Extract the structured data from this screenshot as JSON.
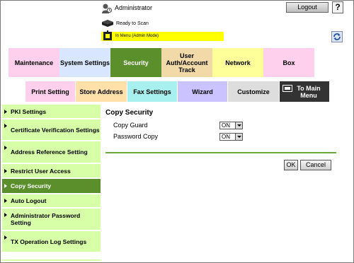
{
  "header": {
    "user_label": "Administrator",
    "logout_label": "Logout",
    "help_label": "?",
    "status_text": "Ready to Scan",
    "mode_text": "In Menu (Admin Mode)"
  },
  "tabs": [
    {
      "label": "Maintenance",
      "color": "#ffd0ee"
    },
    {
      "label": "System Settings",
      "color": "#d8e7ff"
    },
    {
      "label": "Security",
      "color": "#5b8f2c",
      "active": true
    },
    {
      "label": "User Auth/Account Track",
      "color": "#f2d9a8"
    },
    {
      "label": "Network",
      "color": "#ffff99"
    },
    {
      "label": "Box",
      "color": "#ffd0ee"
    }
  ],
  "subtabs": [
    {
      "label": "Print Setting",
      "color": "#ffd0ee"
    },
    {
      "label": "Store Address",
      "color": "#ffe0a8"
    },
    {
      "label": "Fax Settings",
      "color": "#a8f0f0"
    },
    {
      "label": "Wizard",
      "color": "#cbc3ff"
    },
    {
      "label": "Customize",
      "color": "#dddddd"
    },
    {
      "label": "To Main Menu",
      "color": "#333333"
    }
  ],
  "sidebar": {
    "items": [
      {
        "label": "PKI Settings"
      },
      {
        "label": "Certificate Verification Settings"
      },
      {
        "label": "Address Reference Setting"
      },
      {
        "label": "Restrict User Access"
      },
      {
        "label": "Copy Security",
        "active": true
      },
      {
        "label": "Auto Logout"
      },
      {
        "label": "Administrator Password Setting"
      },
      {
        "label": "TX Operation Log Settings"
      }
    ]
  },
  "main": {
    "title": "Copy Security",
    "fields": [
      {
        "label": "Copy Guard",
        "value": "ON"
      },
      {
        "label": "Password Copy",
        "value": "ON"
      }
    ],
    "ok_label": "OK",
    "cancel_label": "Cancel"
  }
}
